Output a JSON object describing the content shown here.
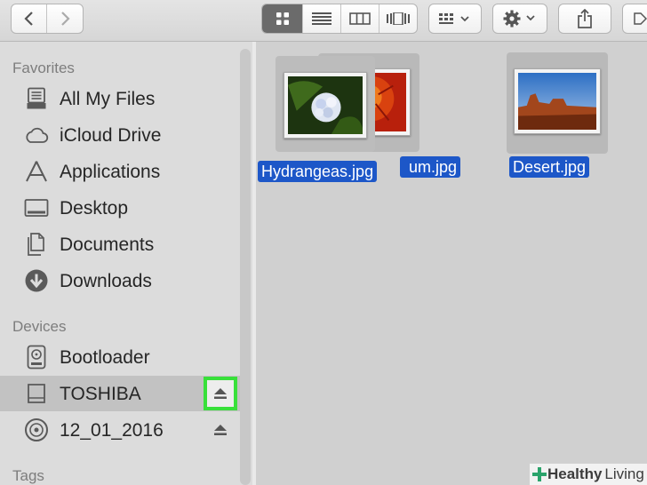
{
  "toolbar": {
    "nav": [
      "back-icon",
      "forward-icon"
    ],
    "view_modes": [
      "icon-view",
      "list-view",
      "column-view",
      "cover-flow-view"
    ],
    "active_view": "icon-view"
  },
  "sidebar": {
    "favorites_header": "Favorites",
    "favorites": [
      {
        "label": "All My Files",
        "icon": "all-files-icon"
      },
      {
        "label": "iCloud Drive",
        "icon": "cloud-icon"
      },
      {
        "label": "Applications",
        "icon": "applications-icon"
      },
      {
        "label": "Desktop",
        "icon": "desktop-icon"
      },
      {
        "label": "Documents",
        "icon": "documents-icon"
      },
      {
        "label": "Downloads",
        "icon": "downloads-icon"
      }
    ],
    "devices_header": "Devices",
    "devices": [
      {
        "label": "Bootloader",
        "icon": "disk-icon"
      },
      {
        "label": "TOSHIBA",
        "icon": "external-drive-icon",
        "selected": true,
        "eject": true
      },
      {
        "label": "12_01_2016",
        "icon": "disc-icon",
        "eject": true
      }
    ],
    "tags_header": "Tags"
  },
  "files": [
    {
      "name": "Hydrangeas.jpg",
      "selected": true
    },
    {
      "name": "um.jpg",
      "selected": true
    },
    {
      "name": "Desert.jpg",
      "selected": true
    }
  ],
  "watermark": {
    "brand_bold": "Healthy",
    "brand_rest": "Living"
  },
  "colors": {
    "selection": "#1d57c8",
    "highlight_box": "#38e03a"
  }
}
